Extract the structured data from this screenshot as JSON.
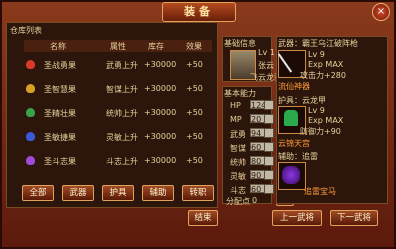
{
  "title": "装备",
  "close_label": "×",
  "warehouse": {
    "section_label": "仓库列表",
    "columns": [
      "名称",
      "属性",
      "库存",
      "效果"
    ],
    "items": [
      {
        "name": "圣战勇果",
        "attr": "武勇上升",
        "stock": "+30000",
        "effect": "+50",
        "color": "#d83a2a"
      },
      {
        "name": "圣智慧果",
        "attr": "智谋上升",
        "stock": "+30000",
        "effect": "+50",
        "color": "#d8a020"
      },
      {
        "name": "圣精壮果",
        "attr": "统帅上升",
        "stock": "+30000",
        "effect": "+50",
        "color": "#3aa04a"
      },
      {
        "name": "圣敏捷果",
        "attr": "灵敏上升",
        "stock": "+30000",
        "effect": "+50",
        "color": "#3a5ad8"
      },
      {
        "name": "圣斗志果",
        "attr": "斗志上升",
        "stock": "+30000",
        "effect": "+50",
        "color": "#a04ad8"
      }
    ],
    "filter_buttons": [
      "全部",
      "武器",
      "护具",
      "辅助",
      "转职"
    ]
  },
  "info": {
    "section_label": "基础信息",
    "level": "Lv 1",
    "name": "张云",
    "title": "飞云龙骑"
  },
  "ability": {
    "section_label": "基本能力",
    "stats": [
      {
        "name": "HP",
        "value": "124"
      },
      {
        "name": "MP",
        "value": "20"
      },
      {
        "name": "武勇",
        "value": "94"
      },
      {
        "name": "智谋",
        "value": "60"
      },
      {
        "name": "统帅",
        "value": "80"
      },
      {
        "name": "灵敏",
        "value": "90"
      },
      {
        "name": "斗志",
        "value": "60"
      }
    ],
    "points_label": "分配点",
    "points_value": "0",
    "reset_label": "重置"
  },
  "equipment": {
    "weapon": {
      "label": "武器：霸王乌江破阵枪",
      "level": "Lv 9",
      "exp": "Exp MAX",
      "stat": "攻击力+280",
      "note": "流仙神器"
    },
    "armor": {
      "label": "护具：云龙甲",
      "level": "Lv 9",
      "exp": "Exp MAX",
      "stat": "防御力+90",
      "note": "云锦天宫"
    },
    "aux": {
      "label": "辅助：追雷",
      "note": "追雷宝马"
    }
  },
  "footer": {
    "close_label": "结束",
    "prev_label": "上一武将",
    "next_label": "下一武将"
  }
}
